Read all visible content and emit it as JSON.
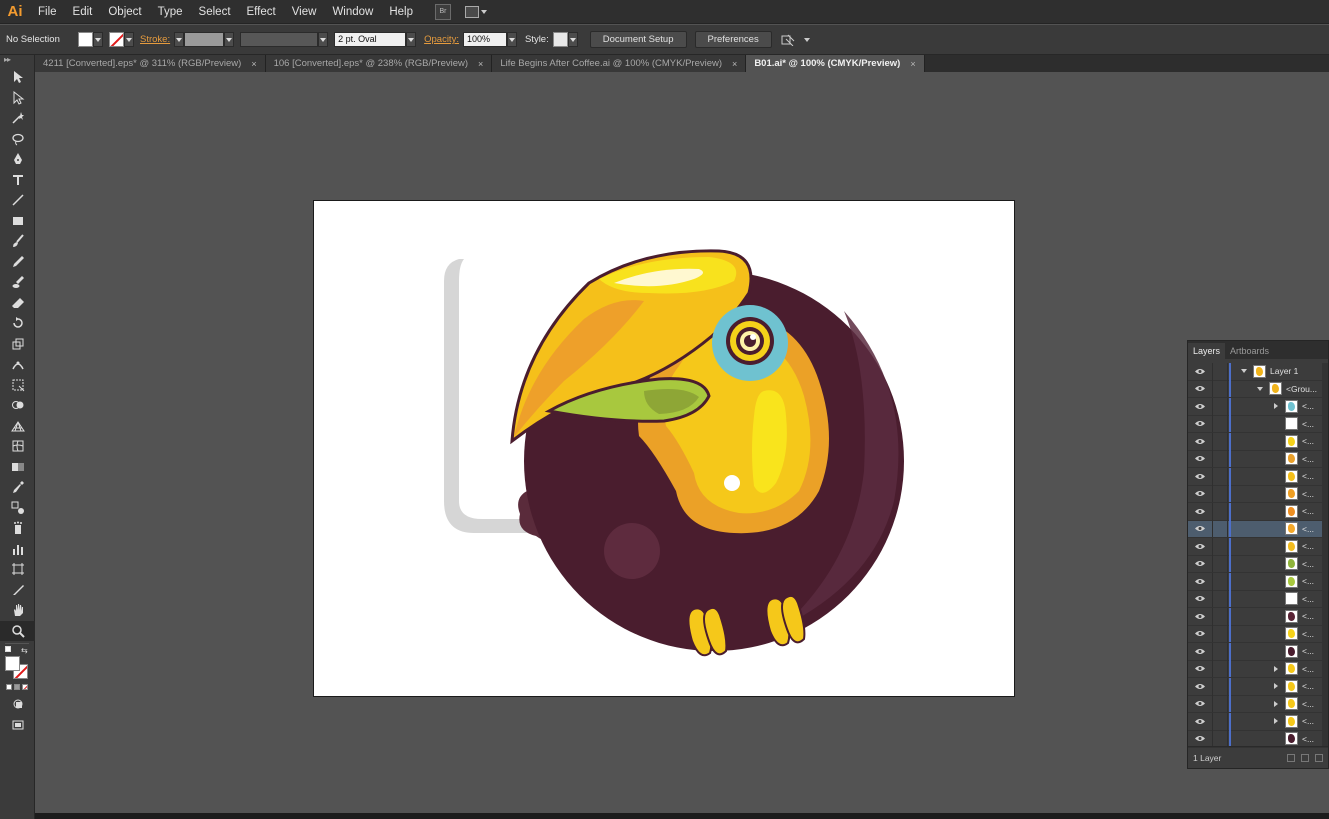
{
  "app": {
    "logo": "Ai",
    "menu": [
      "File",
      "Edit",
      "Object",
      "Type",
      "Select",
      "Effect",
      "View",
      "Window",
      "Help"
    ],
    "bridge_button": "Br"
  },
  "control_bar": {
    "selection_label": "No Selection",
    "stroke_label": "Stroke:",
    "brush_value": "2 pt. Oval",
    "opacity_label": "Opacity:",
    "opacity_value": "100%",
    "style_label": "Style:",
    "document_setup_button": "Document Setup",
    "preferences_button": "Preferences"
  },
  "tabs": [
    {
      "label": "4211 [Converted].eps* @ 311% (RGB/Preview)",
      "active": false
    },
    {
      "label": "106 [Converted].eps* @ 238% (RGB/Preview)",
      "active": false
    },
    {
      "label": "Life Begins After Coffee.ai @ 100% (CMYK/Preview)",
      "active": false
    },
    {
      "label": "B01.ai* @ 100% (CMYK/Preview)",
      "active": true
    }
  ],
  "tab_close_glyph": "×",
  "tools": [
    "selection-tool-icon",
    "direct-selection-tool-icon",
    "magic-wand-tool-icon",
    "lasso-tool-icon",
    "pen-tool-icon",
    "type-tool-icon",
    "line-segment-tool-icon",
    "rectangle-tool-icon",
    "paintbrush-tool-icon",
    "pencil-tool-icon",
    "blob-brush-tool-icon",
    "eraser-tool-icon",
    "rotate-tool-icon",
    "scale-tool-icon",
    "width-tool-icon",
    "free-transform-tool-icon",
    "shape-builder-tool-icon",
    "perspective-grid-tool-icon",
    "mesh-tool-icon",
    "gradient-tool-icon",
    "eyedropper-tool-icon",
    "blend-tool-icon",
    "symbol-sprayer-tool-icon",
    "column-graph-tool-icon",
    "artboard-tool-icon",
    "slice-tool-icon",
    "hand-tool-icon",
    "zoom-tool-icon"
  ],
  "layers_panel": {
    "tabs": [
      {
        "label": "Layers",
        "active": true
      },
      {
        "label": "Artboards",
        "active": false
      }
    ],
    "rows": [
      {
        "name": "Layer 1",
        "depth": 0,
        "expand": "down",
        "thumb": "#f1b41c",
        "selected": false
      },
      {
        "name": "<Grou...",
        "depth": 1,
        "expand": "down",
        "thumb": "#f1b41c",
        "selected": false
      },
      {
        "name": "<...",
        "depth": 2,
        "expand": "right",
        "thumb": "#6fc2d0",
        "selected": false
      },
      {
        "name": "<...",
        "depth": 2,
        "expand": "",
        "thumb": "#ffffff",
        "selected": false
      },
      {
        "name": "<...",
        "depth": 2,
        "expand": "",
        "thumb": "#f5d21a",
        "selected": false
      },
      {
        "name": "<...",
        "depth": 2,
        "expand": "",
        "thumb": "#e9a02b",
        "selected": false
      },
      {
        "name": "<...",
        "depth": 2,
        "expand": "",
        "thumb": "#f5c01a",
        "selected": false
      },
      {
        "name": "<...",
        "depth": 2,
        "expand": "",
        "thumb": "#ef9f24",
        "selected": false
      },
      {
        "name": "<...",
        "depth": 2,
        "expand": "",
        "thumb": "#ee8f22",
        "selected": false
      },
      {
        "name": "<...",
        "depth": 2,
        "expand": "",
        "thumb": "#f4a82a",
        "selected": true
      },
      {
        "name": "<...",
        "depth": 2,
        "expand": "",
        "thumb": "#f3bd20",
        "selected": false
      },
      {
        "name": "<...",
        "depth": 2,
        "expand": "",
        "thumb": "#8fb43a",
        "selected": false
      },
      {
        "name": "<...",
        "depth": 2,
        "expand": "",
        "thumb": "#a8c83e",
        "selected": false
      },
      {
        "name": "<...",
        "depth": 2,
        "expand": "",
        "thumb": "#ffffff",
        "selected": false
      },
      {
        "name": "<...",
        "depth": 2,
        "expand": "",
        "thumb": "#5a2436",
        "selected": false
      },
      {
        "name": "<...",
        "depth": 2,
        "expand": "",
        "thumb": "#f5d21a",
        "selected": false
      },
      {
        "name": "<...",
        "depth": 2,
        "expand": "",
        "thumb": "#4a1d2e",
        "selected": false
      },
      {
        "name": "<...",
        "depth": 2,
        "expand": "right",
        "thumb": "#f5c81a",
        "selected": false
      },
      {
        "name": "<...",
        "depth": 2,
        "expand": "right",
        "thumb": "#f5c81a",
        "selected": false
      },
      {
        "name": "<...",
        "depth": 2,
        "expand": "right",
        "thumb": "#f5c81a",
        "selected": false
      },
      {
        "name": "<...",
        "depth": 2,
        "expand": "right",
        "thumb": "#f5c81a",
        "selected": false
      },
      {
        "name": "<...",
        "depth": 2,
        "expand": "",
        "thumb": "#4a1d2e",
        "selected": false
      }
    ],
    "footer_label": "1 Layer"
  },
  "colors": {
    "accent_orange": "#f39b2f",
    "layer_color": "#4d6fc9",
    "toucan_body": "#4a1d2e",
    "toucan_beak": "#f5d21a",
    "toucan_eye_ring": "#6fc2d0"
  }
}
